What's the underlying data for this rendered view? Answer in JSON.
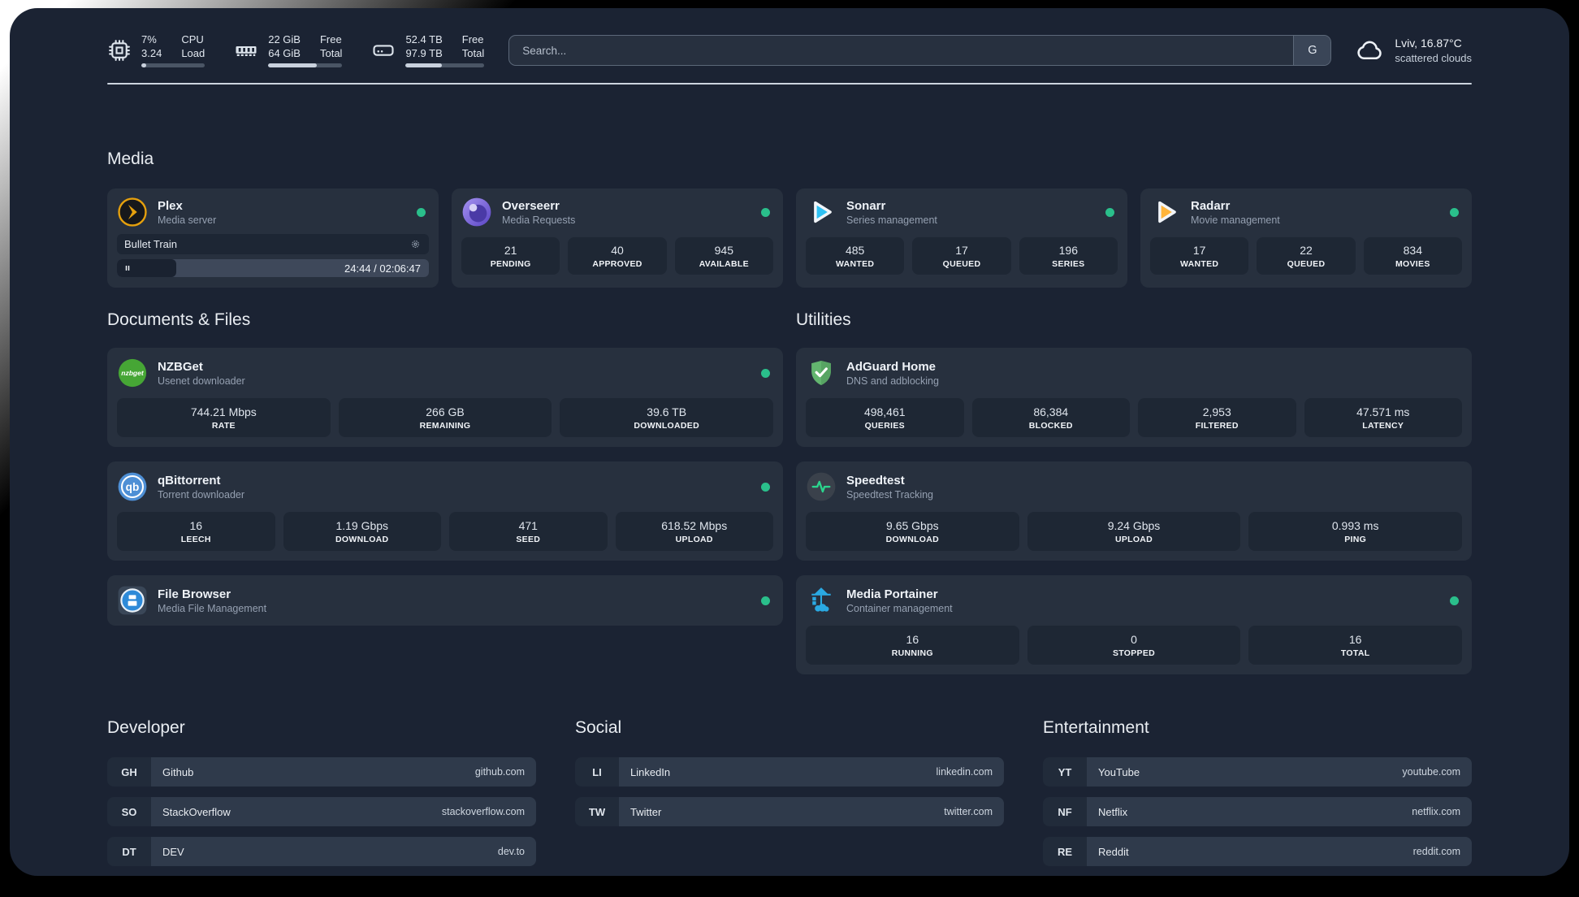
{
  "colors": {
    "status_online": "#2abf8b",
    "plex_accent": "#e5a00d",
    "sonarr_accent": "#2fc1f3",
    "radarr_accent": "#ffb43a",
    "background": "#1b2333"
  },
  "topbar": {
    "resources": [
      {
        "icon": "cpu-icon",
        "values": [
          "7%",
          "3.24"
        ],
        "labels": [
          "CPU",
          "Load"
        ],
        "progress_pct": 8
      },
      {
        "icon": "ram-icon",
        "values": [
          "22 GiB",
          "64 GiB"
        ],
        "labels": [
          "Free",
          "Total"
        ],
        "progress_pct": 66
      },
      {
        "icon": "disk-icon",
        "values": [
          "52.4 TB",
          "97.9 TB"
        ],
        "labels": [
          "Free",
          "Total"
        ],
        "progress_pct": 46
      }
    ],
    "search": {
      "placeholder": "Search...",
      "engine": "G"
    },
    "weather": {
      "icon": "cloud-icon",
      "line1": "Lviv, 16.87°C",
      "line2": "scattered clouds"
    }
  },
  "sections": {
    "media": {
      "title": "Media",
      "cards": [
        {
          "id": "plex",
          "icon": "plex-icon",
          "name": "Plex",
          "subtitle": "Media server",
          "online": true,
          "player": {
            "title": "Bullet Train",
            "elapsed": "24:44",
            "duration": "02:06:47",
            "progress_pct": 19
          }
        },
        {
          "id": "overseerr",
          "icon": "overseerr-icon",
          "name": "Overseerr",
          "subtitle": "Media Requests",
          "online": true,
          "stats": [
            {
              "value": "21",
              "label": "PENDING"
            },
            {
              "value": "40",
              "label": "APPROVED"
            },
            {
              "value": "945",
              "label": "AVAILABLE"
            }
          ]
        },
        {
          "id": "sonarr",
          "icon": "sonarr-icon",
          "name": "Sonarr",
          "subtitle": "Series management",
          "online": true,
          "stats": [
            {
              "value": "485",
              "label": "WANTED"
            },
            {
              "value": "17",
              "label": "QUEUED"
            },
            {
              "value": "196",
              "label": "SERIES"
            }
          ]
        },
        {
          "id": "radarr",
          "icon": "radarr-icon",
          "name": "Radarr",
          "subtitle": "Movie management",
          "online": true,
          "stats": [
            {
              "value": "17",
              "label": "WANTED"
            },
            {
              "value": "22",
              "label": "QUEUED"
            },
            {
              "value": "834",
              "label": "MOVIES"
            }
          ]
        }
      ]
    },
    "documents": {
      "title": "Documents & Files",
      "cards": [
        {
          "id": "nzbget",
          "icon": "nzbget-icon",
          "name": "NZBGet",
          "subtitle": "Usenet downloader",
          "online": true,
          "stats": [
            {
              "value": "744.21 Mbps",
              "label": "RATE"
            },
            {
              "value": "266 GB",
              "label": "REMAINING"
            },
            {
              "value": "39.6 TB",
              "label": "DOWNLOADED"
            }
          ]
        },
        {
          "id": "qbittorrent",
          "icon": "qbittorrent-icon",
          "name": "qBittorrent",
          "subtitle": "Torrent downloader",
          "online": true,
          "stats": [
            {
              "value": "16",
              "label": "LEECH"
            },
            {
              "value": "1.19 Gbps",
              "label": "DOWNLOAD"
            },
            {
              "value": "471",
              "label": "SEED"
            },
            {
              "value": "618.52 Mbps",
              "label": "UPLOAD"
            }
          ]
        },
        {
          "id": "filebrowser",
          "icon": "filebrowser-icon",
          "name": "File Browser",
          "subtitle": "Media File Management",
          "online": true
        }
      ]
    },
    "utilities": {
      "title": "Utilities",
      "cards": [
        {
          "id": "adguard",
          "icon": "adguard-icon",
          "name": "AdGuard Home",
          "subtitle": "DNS and adblocking",
          "online": false,
          "stats": [
            {
              "value": "498,461",
              "label": "QUERIES"
            },
            {
              "value": "86,384",
              "label": "BLOCKED"
            },
            {
              "value": "2,953",
              "label": "FILTERED"
            },
            {
              "value": "47.571 ms",
              "label": "LATENCY"
            }
          ]
        },
        {
          "id": "speedtest",
          "icon": "speedtest-icon",
          "name": "Speedtest",
          "subtitle": "Speedtest Tracking",
          "online": false,
          "stats": [
            {
              "value": "9.65 Gbps",
              "label": "DOWNLOAD"
            },
            {
              "value": "9.24 Gbps",
              "label": "UPLOAD"
            },
            {
              "value": "0.993 ms",
              "label": "PING"
            }
          ]
        },
        {
          "id": "portainer",
          "icon": "portainer-icon",
          "name": "Media Portainer",
          "subtitle": "Container management",
          "online": true,
          "stats": [
            {
              "value": "16",
              "label": "RUNNING"
            },
            {
              "value": "0",
              "label": "STOPPED"
            },
            {
              "value": "16",
              "label": "TOTAL"
            }
          ]
        }
      ]
    }
  },
  "link_sections": [
    {
      "title": "Developer",
      "items": [
        {
          "abbr": "GH",
          "name": "Github",
          "url": "github.com"
        },
        {
          "abbr": "SO",
          "name": "StackOverflow",
          "url": "stackoverflow.com"
        },
        {
          "abbr": "DT",
          "name": "DEV",
          "url": "dev.to"
        }
      ]
    },
    {
      "title": "Social",
      "items": [
        {
          "abbr": "LI",
          "name": "LinkedIn",
          "url": "linkedin.com"
        },
        {
          "abbr": "TW",
          "name": "Twitter",
          "url": "twitter.com"
        }
      ]
    },
    {
      "title": "Entertainment",
      "items": [
        {
          "abbr": "YT",
          "name": "YouTube",
          "url": "youtube.com"
        },
        {
          "abbr": "NF",
          "name": "Netflix",
          "url": "netflix.com"
        },
        {
          "abbr": "RE",
          "name": "Reddit",
          "url": "reddit.com"
        }
      ]
    }
  ]
}
